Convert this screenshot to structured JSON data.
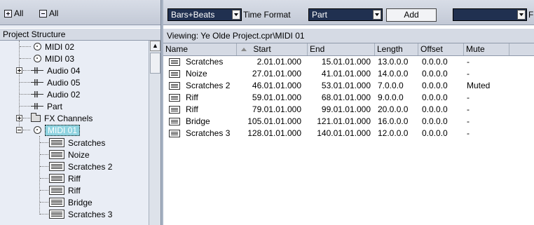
{
  "left_toolbar": {
    "expand_all": "All",
    "collapse_all": "All"
  },
  "project_structure": {
    "header": "Project Structure",
    "items": [
      {
        "label": "MIDI 02",
        "icon": "midi-icon"
      },
      {
        "label": "MIDI 03",
        "icon": "midi-icon"
      },
      {
        "label": "Audio 04",
        "icon": "audio-icon"
      },
      {
        "label": "Audio 05",
        "icon": "audio-icon"
      },
      {
        "label": "Audio 02",
        "icon": "audio-icon"
      },
      {
        "label": "Part",
        "icon": "audio-icon"
      },
      {
        "label": "FX Channels",
        "icon": "folder-icon"
      },
      {
        "label": "MIDI 01",
        "icon": "midi-icon"
      },
      {
        "label": "Scratches",
        "icon": "part-icon"
      },
      {
        "label": "Noize",
        "icon": "part-icon"
      },
      {
        "label": "Scratches 2",
        "icon": "part-icon"
      },
      {
        "label": "Riff",
        "icon": "part-icon"
      },
      {
        "label": "Riff",
        "icon": "part-icon"
      },
      {
        "label": "Bridge",
        "icon": "part-icon"
      },
      {
        "label": "Scratches 3",
        "icon": "part-icon"
      }
    ]
  },
  "toolbar": {
    "format_value": "Bars+Beats",
    "time_format_label": "Time Format",
    "type_value": "Part",
    "add_label": "Add",
    "right_dropdown_value": "",
    "clipped_label": "F"
  },
  "viewing": "Viewing: Ye Olde Project.cpr\\MIDI 01",
  "table": {
    "columns": [
      "Name",
      "Start",
      "End",
      "Length",
      "Offset",
      "Mute"
    ],
    "rows": [
      {
        "name": "Scratches",
        "start": "2.01.01.000",
        "end": "15.01.01.000",
        "length": "13.0.0.0",
        "offset": "0.0.0.0",
        "mute": "-"
      },
      {
        "name": "Noize",
        "start": "27.01.01.000",
        "end": "41.01.01.000",
        "length": "14.0.0.0",
        "offset": "0.0.0.0",
        "mute": "-"
      },
      {
        "name": "Scratches 2",
        "start": "46.01.01.000",
        "end": "53.01.01.000",
        "length": "7.0.0.0",
        "offset": "0.0.0.0",
        "mute": "Muted"
      },
      {
        "name": "Riff",
        "start": "59.01.01.000",
        "end": "68.01.01.000",
        "length": "9.0.0.0",
        "offset": "0.0.0.0",
        "mute": "-"
      },
      {
        "name": "Riff",
        "start": "79.01.01.000",
        "end": "99.01.01.000",
        "length": "20.0.0.0",
        "offset": "0.0.0.0",
        "mute": "-"
      },
      {
        "name": "Bridge",
        "start": "105.01.01.000",
        "end": "121.01.01.000",
        "length": "16.0.0.0",
        "offset": "0.0.0.0",
        "mute": "-"
      },
      {
        "name": "Scratches 3",
        "start": "128.01.01.000",
        "end": "140.01.01.000",
        "length": "12.0.0.0",
        "offset": "0.0.0.0",
        "mute": "-"
      }
    ]
  },
  "colors": {
    "selected_highlight": "#8fd3e0",
    "dropdown_bg": "#203050"
  }
}
